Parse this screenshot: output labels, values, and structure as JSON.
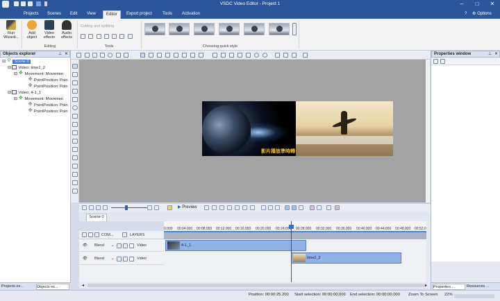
{
  "window": {
    "title": "VSDC Video Editor - Project 1",
    "options": "Options"
  },
  "menu": {
    "items": [
      "Projects",
      "Scenes",
      "Edit",
      "View",
      "Editor",
      "Export project",
      "Tools",
      "Activation"
    ],
    "active": "Editor"
  },
  "ribbon": {
    "run_wizard": "Run\nWizard...",
    "add_object": "Add\nobject",
    "video_effects": "Video\neffects",
    "audio_effects": "Audio\neffects",
    "group_editing": "Editing",
    "cutting": "Cutting and splitting",
    "group_tools": "Tools",
    "group_quick_style": "Choosing quick style"
  },
  "objects_explorer": {
    "title": "Objects explorer",
    "tree": [
      {
        "label": "Scene 0",
        "selected": true
      },
      {
        "label": "Video: time2_2"
      },
      {
        "label": "Movement: Movemen"
      },
      {
        "label": "PointPosition: Poin"
      },
      {
        "label": "PointPosition: Poin"
      },
      {
        "label": "Video: 4-1_1"
      },
      {
        "label": "Movement: Movemen"
      },
      {
        "label": "PointPosition: Poin"
      },
      {
        "label": "PointPosition: Poin"
      }
    ],
    "tabs": [
      "Projects ex...",
      "Objects ex..."
    ]
  },
  "properties": {
    "title": "Properties window",
    "tabs": [
      "Properties ...",
      "Resources ..."
    ]
  },
  "preview": {
    "caption": "影片播放準時轉"
  },
  "timeline": {
    "preview_label": "Preview",
    "scene_tab": "Scene 0",
    "header_com": "COM...",
    "header_layers": "LAYERS",
    "ruler": [
      "0.000",
      "00:04.000",
      "00:08.000",
      "00:12.000",
      "00:16.000",
      "00:20.000",
      "00:24.000",
      "00:28.000",
      "00:32.000",
      "00:36.000",
      "00:40.000",
      "00:44.000",
      "00:48.000",
      "00:52.0"
    ],
    "tracks": [
      {
        "blend": "Blend",
        "type": "Video",
        "clip": "4-1_1"
      },
      {
        "blend": "Blend",
        "type": "Video",
        "clip": "time2_2"
      }
    ]
  },
  "status": {
    "position": "Position:  00:00:25.200",
    "start_selection": "Start selection:  00:00:00.000",
    "end_selection": "End selection:  00:00:00.000",
    "zoom": "Zoom To Screen",
    "zoom_pct": "22%"
  }
}
